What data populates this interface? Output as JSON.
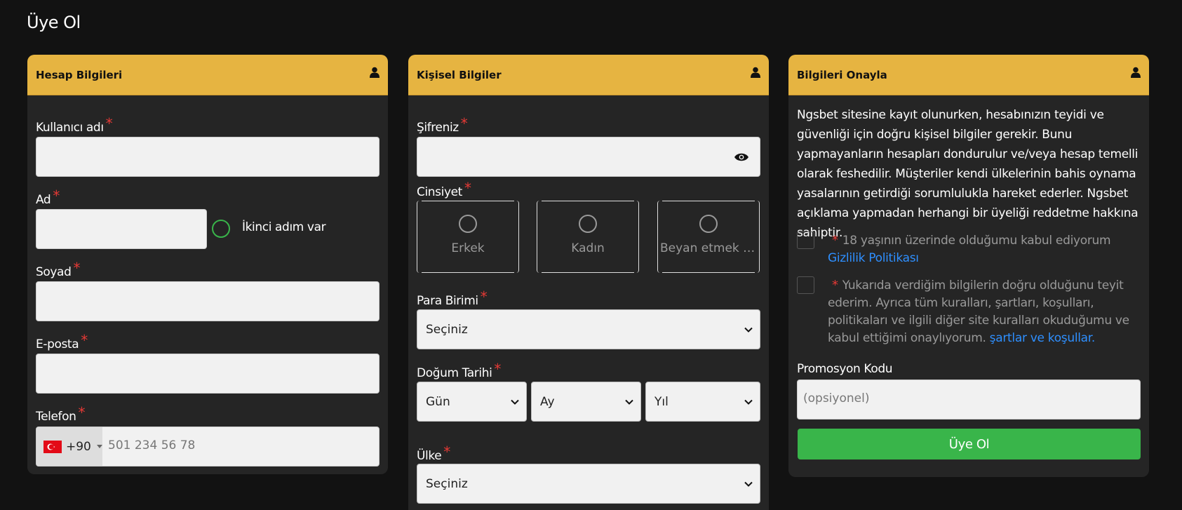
{
  "page": {
    "title": "Üye Ol"
  },
  "account": {
    "header": "Hesap Bilgileri",
    "username_label": "Kullanıcı adı",
    "name_label": "Ad",
    "second_step_text": "İkinci adım var",
    "surname_label": "Soyad",
    "email_label": "E-posta",
    "phone_label": "Telefon",
    "phone_code": "+90",
    "phone_placeholder": "501 234 56 78"
  },
  "personal": {
    "header": "Kişisel Bilgiler",
    "password_label": "Şifreniz",
    "gender_label": "Cinsiyet",
    "gender_options": [
      "Erkek",
      "Kadın",
      "Beyan etmek is..."
    ],
    "currency_label": "Para Birimi",
    "currency_value": "Seçiniz",
    "birthdate_label": "Doğum Tarihi",
    "day_value": "Gün",
    "month_value": "Ay",
    "year_value": "Yıl",
    "country_label": "Ülke",
    "country_value": "Seçiniz"
  },
  "confirm": {
    "header": "Bilgileri Onayla",
    "paragraph": "Ngsbet sitesine kayıt olunurken, hesabınızın teyidi ve güvenliği için doğru kişisel bilgiler gerekir. Bunu yapmayanların hesapları dondurulur ve/veya hesap temelli olarak feshedilir. Müşteriler kendi ülkelerinin bahis oynama yasalarının getirdiği sorumlulukla hareket ederler. Ngsbet açıklama yapmadan herhangi bir üyeliği reddetme hakkına sahiptir.",
    "age_text": "18 yaşının üzerinde olduğumu kabul ediyorum",
    "age_link": "Gizlilik Politikası",
    "terms_text": "Yukarıda verdiğim bilgilerin doğru olduğunu teyit ederim. Ayrıca tüm kuralları, şartları, koşulları, politikaları ve ilgili diğer site kuralları okuduğumu ve kabul ettiğimi onaylıyorum.",
    "terms_link": "şartlar ve koşullar.",
    "promo_label": "Promosyon Kodu",
    "promo_placeholder": "(opsiyonel)",
    "submit_label": "Üye Ol"
  },
  "colors": {
    "accent": "#e6b441",
    "success": "#39b54a",
    "link": "#2e8fff",
    "required": "#e53935"
  },
  "icons": [
    "user-icon",
    "eye-icon",
    "chevron-down-icon",
    "turkey-flag-icon"
  ]
}
